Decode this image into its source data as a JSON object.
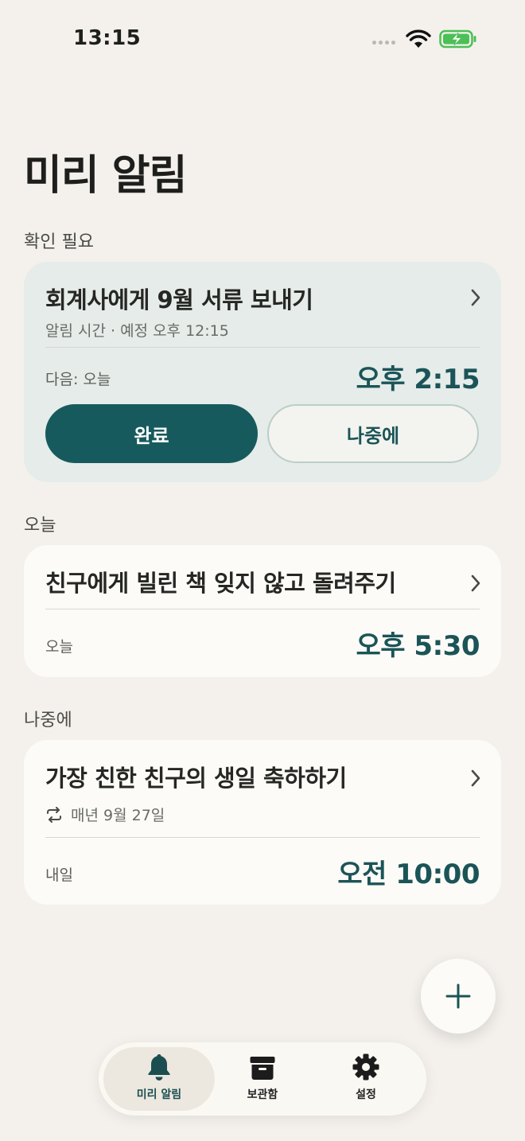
{
  "status": {
    "time": "13:15"
  },
  "page_title": "미리 알림",
  "sections": {
    "needs_check": "확인 필요",
    "today": "오늘",
    "later": "나중에"
  },
  "card_pending": {
    "title": "회계사에게 9월 서류 보내기",
    "subtitle": "알림 시간 · 예정 오후 12:15",
    "next": "다음: 오늘",
    "time": "오후 2:15",
    "done_label": "완료",
    "later_label": "나중에"
  },
  "card_today": {
    "title": "친구에게 빌린 책 잊지 않고 돌려주기",
    "when": "오늘",
    "time": "오후 5:30"
  },
  "card_later": {
    "title": "가장 친한 친구의 생일 축하하기",
    "repeat": "매년 9월 27일",
    "when": "내일",
    "time": "오전 10:00"
  },
  "tabs": [
    {
      "label": "미리 알림",
      "icon": "bell-icon",
      "active": true
    },
    {
      "label": "보관함",
      "icon": "archive-box-icon",
      "active": false
    },
    {
      "label": "설정",
      "icon": "gear-icon",
      "active": false
    }
  ],
  "colors": {
    "accent": "#175a5e",
    "background": "#f4f1ec",
    "card": "#fcfbf7",
    "highlight_card": "#e5ece9"
  }
}
